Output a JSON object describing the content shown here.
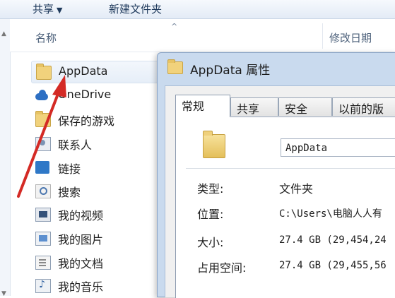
{
  "toolbar": {
    "share_label": "共享",
    "share_arrow": "▼",
    "new_folder_label": "新建文件夹"
  },
  "list_header": {
    "name_column": "名称",
    "date_column": "修改日期"
  },
  "files": [
    {
      "name": "AppData",
      "icon": "folder-icon",
      "selected": true
    },
    {
      "name": "OneDrive",
      "icon": "onedrive-icon"
    },
    {
      "name": "保存的游戏",
      "icon": "folder-icon"
    },
    {
      "name": "联系人",
      "icon": "contacts-icon"
    },
    {
      "name": "链接",
      "icon": "links-icon"
    },
    {
      "name": "搜索",
      "icon": "search-icon"
    },
    {
      "name": "我的视频",
      "icon": "videos-icon"
    },
    {
      "name": "我的图片",
      "icon": "pictures-icon"
    },
    {
      "name": "我的文档",
      "icon": "documents-icon"
    },
    {
      "name": "我的音乐",
      "icon": "music-icon"
    }
  ],
  "dialog": {
    "title": "AppData 属性",
    "tabs": [
      "常规",
      "共享",
      "安全",
      "以前的版"
    ],
    "active_tab": "常规",
    "folder_name": "AppData",
    "properties": [
      {
        "label": "类型:",
        "value": "文件夹"
      },
      {
        "label": "位置:",
        "value": "C:\\Users\\电脑人人有"
      },
      {
        "label": "大小:",
        "value": "27.4 GB (29,454,24"
      },
      {
        "label": "占用空间:",
        "value": "27.4 GB (29,455,56"
      }
    ]
  },
  "colors": {
    "annotation_arrow": "#d42a25",
    "dialog_frame": "#c9daee"
  }
}
